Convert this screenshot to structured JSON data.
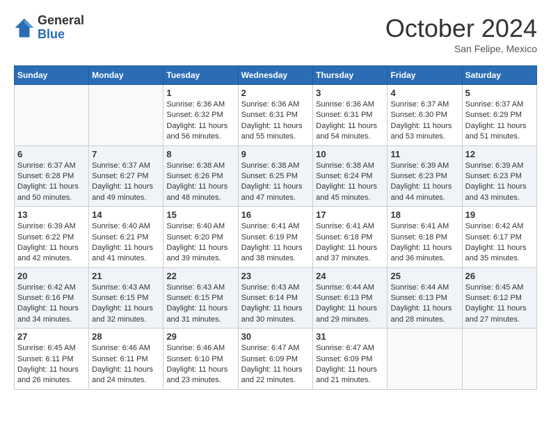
{
  "header": {
    "logo_general": "General",
    "logo_blue": "Blue",
    "month_title": "October 2024",
    "location": "San Felipe, Mexico"
  },
  "days_of_week": [
    "Sunday",
    "Monday",
    "Tuesday",
    "Wednesday",
    "Thursday",
    "Friday",
    "Saturday"
  ],
  "weeks": [
    [
      {
        "day": "",
        "sunrise": "",
        "sunset": "",
        "daylight": ""
      },
      {
        "day": "",
        "sunrise": "",
        "sunset": "",
        "daylight": ""
      },
      {
        "day": "1",
        "sunrise": "Sunrise: 6:36 AM",
        "sunset": "Sunset: 6:32 PM",
        "daylight": "Daylight: 11 hours and 56 minutes."
      },
      {
        "day": "2",
        "sunrise": "Sunrise: 6:36 AM",
        "sunset": "Sunset: 6:31 PM",
        "daylight": "Daylight: 11 hours and 55 minutes."
      },
      {
        "day": "3",
        "sunrise": "Sunrise: 6:36 AM",
        "sunset": "Sunset: 6:31 PM",
        "daylight": "Daylight: 11 hours and 54 minutes."
      },
      {
        "day": "4",
        "sunrise": "Sunrise: 6:37 AM",
        "sunset": "Sunset: 6:30 PM",
        "daylight": "Daylight: 11 hours and 53 minutes."
      },
      {
        "day": "5",
        "sunrise": "Sunrise: 6:37 AM",
        "sunset": "Sunset: 6:29 PM",
        "daylight": "Daylight: 11 hours and 51 minutes."
      }
    ],
    [
      {
        "day": "6",
        "sunrise": "Sunrise: 6:37 AM",
        "sunset": "Sunset: 6:28 PM",
        "daylight": "Daylight: 11 hours and 50 minutes."
      },
      {
        "day": "7",
        "sunrise": "Sunrise: 6:37 AM",
        "sunset": "Sunset: 6:27 PM",
        "daylight": "Daylight: 11 hours and 49 minutes."
      },
      {
        "day": "8",
        "sunrise": "Sunrise: 6:38 AM",
        "sunset": "Sunset: 6:26 PM",
        "daylight": "Daylight: 11 hours and 48 minutes."
      },
      {
        "day": "9",
        "sunrise": "Sunrise: 6:38 AM",
        "sunset": "Sunset: 6:25 PM",
        "daylight": "Daylight: 11 hours and 47 minutes."
      },
      {
        "day": "10",
        "sunrise": "Sunrise: 6:38 AM",
        "sunset": "Sunset: 6:24 PM",
        "daylight": "Daylight: 11 hours and 45 minutes."
      },
      {
        "day": "11",
        "sunrise": "Sunrise: 6:39 AM",
        "sunset": "Sunset: 6:23 PM",
        "daylight": "Daylight: 11 hours and 44 minutes."
      },
      {
        "day": "12",
        "sunrise": "Sunrise: 6:39 AM",
        "sunset": "Sunset: 6:23 PM",
        "daylight": "Daylight: 11 hours and 43 minutes."
      }
    ],
    [
      {
        "day": "13",
        "sunrise": "Sunrise: 6:39 AM",
        "sunset": "Sunset: 6:22 PM",
        "daylight": "Daylight: 11 hours and 42 minutes."
      },
      {
        "day": "14",
        "sunrise": "Sunrise: 6:40 AM",
        "sunset": "Sunset: 6:21 PM",
        "daylight": "Daylight: 11 hours and 41 minutes."
      },
      {
        "day": "15",
        "sunrise": "Sunrise: 6:40 AM",
        "sunset": "Sunset: 6:20 PM",
        "daylight": "Daylight: 11 hours and 39 minutes."
      },
      {
        "day": "16",
        "sunrise": "Sunrise: 6:41 AM",
        "sunset": "Sunset: 6:19 PM",
        "daylight": "Daylight: 11 hours and 38 minutes."
      },
      {
        "day": "17",
        "sunrise": "Sunrise: 6:41 AM",
        "sunset": "Sunset: 6:18 PM",
        "daylight": "Daylight: 11 hours and 37 minutes."
      },
      {
        "day": "18",
        "sunrise": "Sunrise: 6:41 AM",
        "sunset": "Sunset: 6:18 PM",
        "daylight": "Daylight: 11 hours and 36 minutes."
      },
      {
        "day": "19",
        "sunrise": "Sunrise: 6:42 AM",
        "sunset": "Sunset: 6:17 PM",
        "daylight": "Daylight: 11 hours and 35 minutes."
      }
    ],
    [
      {
        "day": "20",
        "sunrise": "Sunrise: 6:42 AM",
        "sunset": "Sunset: 6:16 PM",
        "daylight": "Daylight: 11 hours and 34 minutes."
      },
      {
        "day": "21",
        "sunrise": "Sunrise: 6:43 AM",
        "sunset": "Sunset: 6:15 PM",
        "daylight": "Daylight: 11 hours and 32 minutes."
      },
      {
        "day": "22",
        "sunrise": "Sunrise: 6:43 AM",
        "sunset": "Sunset: 6:15 PM",
        "daylight": "Daylight: 11 hours and 31 minutes."
      },
      {
        "day": "23",
        "sunrise": "Sunrise: 6:43 AM",
        "sunset": "Sunset: 6:14 PM",
        "daylight": "Daylight: 11 hours and 30 minutes."
      },
      {
        "day": "24",
        "sunrise": "Sunrise: 6:44 AM",
        "sunset": "Sunset: 6:13 PM",
        "daylight": "Daylight: 11 hours and 29 minutes."
      },
      {
        "day": "25",
        "sunrise": "Sunrise: 6:44 AM",
        "sunset": "Sunset: 6:13 PM",
        "daylight": "Daylight: 11 hours and 28 minutes."
      },
      {
        "day": "26",
        "sunrise": "Sunrise: 6:45 AM",
        "sunset": "Sunset: 6:12 PM",
        "daylight": "Daylight: 11 hours and 27 minutes."
      }
    ],
    [
      {
        "day": "27",
        "sunrise": "Sunrise: 6:45 AM",
        "sunset": "Sunset: 6:11 PM",
        "daylight": "Daylight: 11 hours and 26 minutes."
      },
      {
        "day": "28",
        "sunrise": "Sunrise: 6:46 AM",
        "sunset": "Sunset: 6:11 PM",
        "daylight": "Daylight: 11 hours and 24 minutes."
      },
      {
        "day": "29",
        "sunrise": "Sunrise: 6:46 AM",
        "sunset": "Sunset: 6:10 PM",
        "daylight": "Daylight: 11 hours and 23 minutes."
      },
      {
        "day": "30",
        "sunrise": "Sunrise: 6:47 AM",
        "sunset": "Sunset: 6:09 PM",
        "daylight": "Daylight: 11 hours and 22 minutes."
      },
      {
        "day": "31",
        "sunrise": "Sunrise: 6:47 AM",
        "sunset": "Sunset: 6:09 PM",
        "daylight": "Daylight: 11 hours and 21 minutes."
      },
      {
        "day": "",
        "sunrise": "",
        "sunset": "",
        "daylight": ""
      },
      {
        "day": "",
        "sunrise": "",
        "sunset": "",
        "daylight": ""
      }
    ]
  ]
}
